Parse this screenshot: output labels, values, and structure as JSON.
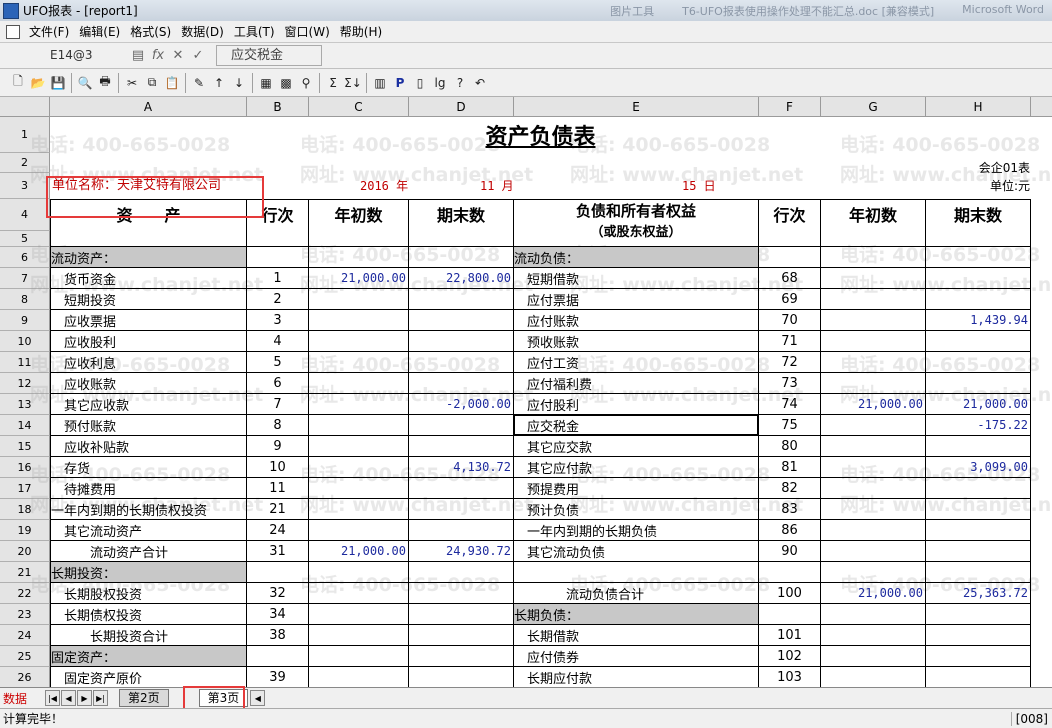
{
  "window": {
    "title": "UFO报表 - [report1]",
    "right_items": [
      "图片工具",
      "T6-UFO报表使用操作处理不能汇总.doc [兼容模式]",
      "Microsoft Word"
    ]
  },
  "menu": [
    "文件(F)",
    "编辑(E)",
    "格式(S)",
    "数据(D)",
    "工具(T)",
    "窗口(W)",
    "帮助(H)"
  ],
  "editbar": {
    "cell_ref": "E14@3",
    "formula": "应交税金"
  },
  "watermark": {
    "phone": "电话: 400-665-0028",
    "web": "网址: www.chanjet.net"
  },
  "columns": [
    "A",
    "B",
    "C",
    "D",
    "E",
    "F",
    "G",
    "H"
  ],
  "report": {
    "title": "资产负债表",
    "form_no": "会企01表",
    "unit_name": "单位名称：天津艾特有限公司",
    "year": "2016 年",
    "month": "11 月",
    "day": "15 日",
    "currency_unit": "单位:元",
    "header": {
      "assets": "资　　产",
      "line_no": "行次",
      "begin": "年初数",
      "end": "期末数",
      "liab_line1": "负债和所有者权益",
      "liab_line2": "（或股东权益）",
      "line_no2": "行次",
      "begin2": "年初数",
      "end2": "期末数"
    },
    "rows": [
      {
        "r": "6",
        "a": "流动资产：",
        "b": "",
        "c": "",
        "d": "",
        "e": "流动负债：",
        "f": "",
        "g": "",
        "h": "",
        "sec_a": true,
        "sec_e": true
      },
      {
        "r": "7",
        "a": "　货币资金",
        "b": "1",
        "c": "21,000.00",
        "d": "22,800.00",
        "e": "　短期借款",
        "f": "68",
        "g": "",
        "h": ""
      },
      {
        "r": "8",
        "a": "　短期投资",
        "b": "2",
        "c": "",
        "d": "",
        "e": "　应付票据",
        "f": "69",
        "g": "",
        "h": ""
      },
      {
        "r": "9",
        "a": "　应收票据",
        "b": "3",
        "c": "",
        "d": "",
        "e": "　应付账款",
        "f": "70",
        "g": "",
        "h": "1,439.94"
      },
      {
        "r": "10",
        "a": "　应收股利",
        "b": "4",
        "c": "",
        "d": "",
        "e": "　预收账款",
        "f": "71",
        "g": "",
        "h": ""
      },
      {
        "r": "11",
        "a": "　应收利息",
        "b": "5",
        "c": "",
        "d": "",
        "e": "　应付工资",
        "f": "72",
        "g": "",
        "h": ""
      },
      {
        "r": "12",
        "a": "　应收账款",
        "b": "6",
        "c": "",
        "d": "",
        "e": "　应付福利费",
        "f": "73",
        "g": "",
        "h": ""
      },
      {
        "r": "13",
        "a": "　其它应收款",
        "b": "7",
        "c": "",
        "d": "-2,000.00",
        "e": "　应付股利",
        "f": "74",
        "g": "21,000.00",
        "h": "21,000.00"
      },
      {
        "r": "14",
        "a": "　预付账款",
        "b": "8",
        "c": "",
        "d": "",
        "e": "　应交税金",
        "f": "75",
        "g": "",
        "h": "-175.22"
      },
      {
        "r": "15",
        "a": "　应收补贴款",
        "b": "9",
        "c": "",
        "d": "",
        "e": "　其它应交款",
        "f": "80",
        "g": "",
        "h": ""
      },
      {
        "r": "16",
        "a": "　存货",
        "b": "10",
        "c": "",
        "d": "4,130.72",
        "e": "　其它应付款",
        "f": "81",
        "g": "",
        "h": "3,099.00"
      },
      {
        "r": "17",
        "a": "　待摊费用",
        "b": "11",
        "c": "",
        "d": "",
        "e": "　预提费用",
        "f": "82",
        "g": "",
        "h": ""
      },
      {
        "r": "18",
        "a": "一年内到期的长期债权投资",
        "b": "21",
        "c": "",
        "d": "",
        "e": "　预计负债",
        "f": "83",
        "g": "",
        "h": ""
      },
      {
        "r": "19",
        "a": "　其它流动资产",
        "b": "24",
        "c": "",
        "d": "",
        "e": "　一年内到期的长期负债",
        "f": "86",
        "g": "",
        "h": ""
      },
      {
        "r": "20",
        "a": "　　　流动资产合计",
        "b": "31",
        "c": "21,000.00",
        "d": "24,930.72",
        "e": "　其它流动负债",
        "f": "90",
        "g": "",
        "h": ""
      },
      {
        "r": "21",
        "a": "长期投资：",
        "b": "",
        "c": "",
        "d": "",
        "e": "",
        "f": "",
        "g": "",
        "h": "",
        "sec_a": true
      },
      {
        "r": "22",
        "a": "　长期股权投资",
        "b": "32",
        "c": "",
        "d": "",
        "e": "　　　　流动负债合计",
        "f": "100",
        "g": "21,000.00",
        "h": "25,363.72"
      },
      {
        "r": "23",
        "a": "　长期债权投资",
        "b": "34",
        "c": "",
        "d": "",
        "e": "长期负债：",
        "f": "",
        "g": "",
        "h": "",
        "sec_e": true
      },
      {
        "r": "24",
        "a": "　　　长期投资合计",
        "b": "38",
        "c": "",
        "d": "",
        "e": "　长期借款",
        "f": "101",
        "g": "",
        "h": ""
      },
      {
        "r": "25",
        "a": "固定资产：",
        "b": "",
        "c": "",
        "d": "",
        "e": "　应付债券",
        "f": "102",
        "g": "",
        "h": "",
        "sec_a": true
      },
      {
        "r": "26",
        "a": "　固定资产原价",
        "b": "39",
        "c": "",
        "d": "",
        "e": "　长期应付款",
        "f": "103",
        "g": "",
        "h": ""
      }
    ]
  },
  "tabs": {
    "mode": "数据",
    "sheets": [
      "第2页",
      "第3页"
    ],
    "active": "第3页"
  },
  "status": {
    "left": "计算完毕！",
    "right": "[008]"
  }
}
